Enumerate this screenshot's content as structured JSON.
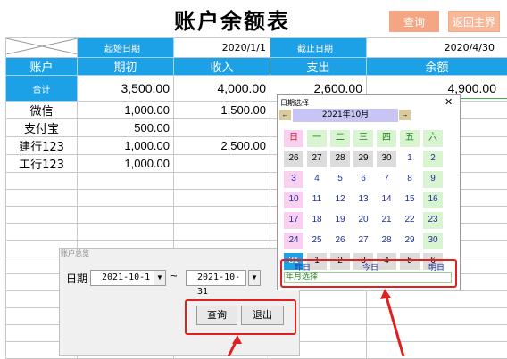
{
  "sheet": {
    "title": "账户余额表",
    "buttons": {
      "query": "查询",
      "back": "返回主界面"
    },
    "date_row": {
      "start_label": "起始日期",
      "start_value": "2020/1/1",
      "end_label": "截止日期",
      "end_value": "2020/4/30"
    },
    "headers": [
      "账户",
      "期初",
      "收入",
      "支出",
      "余额"
    ],
    "total": {
      "label": "合计",
      "opening": "3,500.00",
      "income": "4,000.00",
      "expense": "2,600.00",
      "balance": "4,900.00"
    },
    "rows": [
      {
        "account": "微信",
        "opening": "1,000.00",
        "income": "1,500.00"
      },
      {
        "account": "支付宝",
        "opening": "500.00",
        "income": ""
      },
      {
        "account": "建行123",
        "opening": "1,000.00",
        "income": "2,500.00"
      },
      {
        "account": "工行123",
        "opening": "1,000.00",
        "income": ""
      }
    ]
  },
  "summary_dialog": {
    "title": "账户总览",
    "date_label": "日期",
    "from_value": "2021-10-1",
    "separator": "~",
    "to_value": "2021-10-31",
    "query_label": "查询",
    "exit_label": "退出"
  },
  "date_picker": {
    "title": "日期选择",
    "close": "✕",
    "month_label": "2021年10月",
    "prev": "←",
    "next": "→",
    "weekdays": [
      "日",
      "一",
      "二",
      "三",
      "四",
      "五",
      "六"
    ],
    "weeks": [
      [
        "26",
        "27",
        "28",
        "29",
        "30",
        "1",
        "2"
      ],
      [
        "3",
        "4",
        "5",
        "6",
        "7",
        "8",
        "9"
      ],
      [
        "10",
        "11",
        "12",
        "13",
        "14",
        "15",
        "16"
      ],
      [
        "17",
        "18",
        "19",
        "20",
        "21",
        "22",
        "23"
      ],
      [
        "24",
        "25",
        "26",
        "27",
        "28",
        "29",
        "30"
      ],
      [
        "31",
        "1",
        "2",
        "3",
        "4",
        "5",
        "6"
      ]
    ],
    "quick": {
      "yesterday": "昨日",
      "today": "今日",
      "tomorrow": "明日",
      "month": "年月选择"
    }
  },
  "colors": {
    "header_blue": "#1da1e6",
    "button_orange": "#f4a684",
    "annotation_red": "#e02020",
    "weekend_pink": "#f9d0f0",
    "saturday_green": "#d8f4d0"
  }
}
